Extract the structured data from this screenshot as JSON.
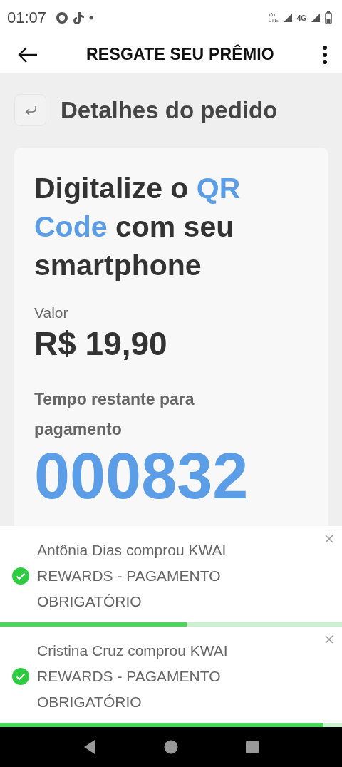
{
  "status_bar": {
    "time": "01:07",
    "volte": "Vo LTE",
    "network": "4G"
  },
  "app_bar": {
    "title": "RESGATE SEU PRÊMIO"
  },
  "header": {
    "title": "Detalhes do pedido"
  },
  "card": {
    "headline": "Digitalize o **QR Code** com seu smartphone",
    "value_label": "Valor",
    "value": "R$ 19,90",
    "timer_label": "Tempo restante para pagamento",
    "timer": "000832"
  },
  "toasts": [
    {
      "message": "Antônia Dias comprou KWAI REWARDS - PAGAMENTO OBRIGATÓRIO",
      "level": 0.545
    },
    {
      "message": "Cristina Cruz comprou KWAI REWARDS - PAGAMENTO OBRIGATÓRIO",
      "level": 0.945
    }
  ]
}
